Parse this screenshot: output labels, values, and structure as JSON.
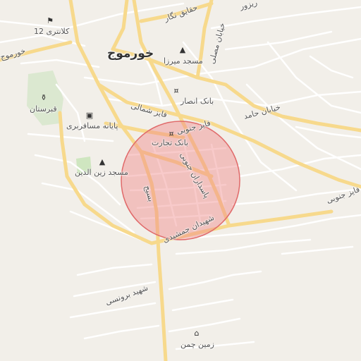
{
  "map": {
    "colors": {
      "background": "#f2efe9",
      "major_road": "#f7d98c",
      "minor_road": "#ffffff",
      "green": "#cfe6c0",
      "highlight": "#f08a8a"
    },
    "labels": {
      "city": "خورموج",
      "road_left_top": "خورموج",
      "kalantari": "کلانتری 12",
      "graveyard": "قبرستان",
      "bus_terminal": "پایانه مسافربری",
      "mosque_mirza": "مسجد میرزا",
      "bank_ansar": "بانک انصار",
      "fayez_shomali": "فایز شمالی",
      "fayez_jonubi": "فایز جنوبی",
      "bank_tejarat": "بانک تجارت",
      "mosque_zein": "مسجد زین الدین",
      "basij": "بسیج",
      "pasdaran_jonubi": "پاسداران جنوبی",
      "shahidan_jamshidi": "شهیدان جمشیدی",
      "shahid_boronsi": "شهید برونسی",
      "zamin_chaman": "زمین چمن",
      "khayaban_mosalla": "خیابان مصلی",
      "khayaban_hamed": "خیابان حامد",
      "haghayegh_negar": "حقایق نگار",
      "top_right_partial": "ریزور",
      "right_fayez_jonubi": "فایز جنوبی"
    }
  }
}
